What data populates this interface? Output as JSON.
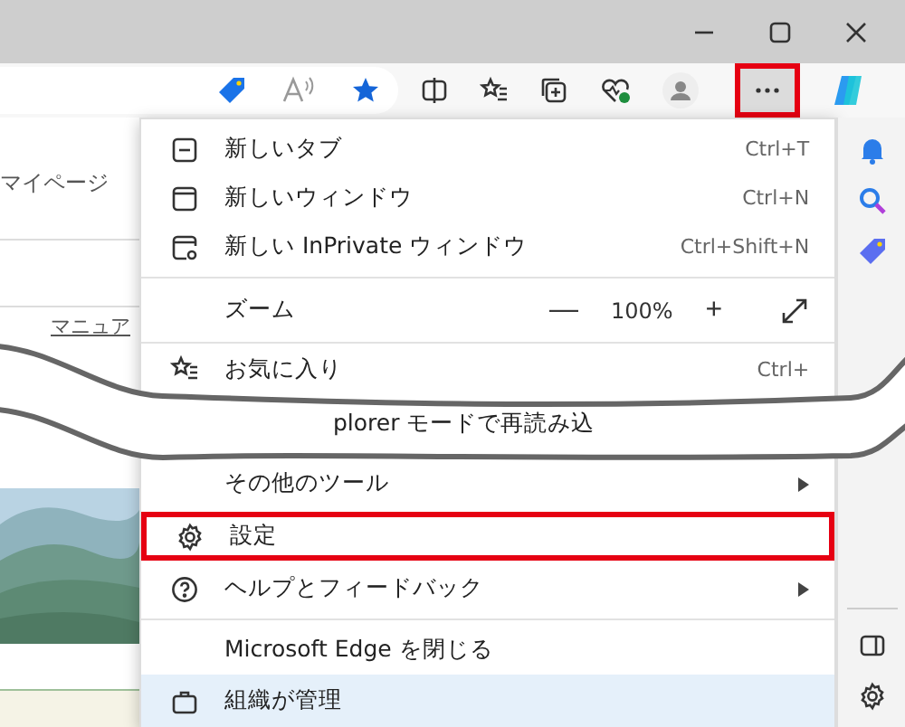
{
  "toolbar": {
    "more_button": {
      "highlighted": true
    }
  },
  "page": {
    "links": [
      "マイページ",
      "マニュア"
    ]
  },
  "menu": {
    "items": [
      {
        "kind": "item",
        "label": "新しいタブ",
        "shortcut": "Ctrl+T",
        "submenu": false,
        "highlighted": false
      },
      {
        "kind": "item",
        "label": "新しいウィンドウ",
        "shortcut": "Ctrl+N",
        "submenu": false,
        "highlighted": false
      },
      {
        "kind": "item",
        "label": "新しい InPrivate ウィンドウ",
        "shortcut": "Ctrl+Shift+N",
        "submenu": false,
        "highlighted": false
      },
      {
        "kind": "divider"
      },
      {
        "kind": "zoom",
        "label": "ズーム",
        "minus": "—",
        "value": "100%",
        "plus": "+"
      },
      {
        "kind": "divider"
      },
      {
        "kind": "item",
        "label": "お気に入り",
        "shortcut": "Ctrl+",
        "submenu": false,
        "highlighted": false
      },
      {
        "kind": "cut",
        "label": "plorer モードで再読み込"
      },
      {
        "kind": "item",
        "label": "その他のツール",
        "submenu": true,
        "highlighted": false
      },
      {
        "kind": "item",
        "label": "設定",
        "submenu": false,
        "highlighted": true
      },
      {
        "kind": "item",
        "label": "ヘルプとフィードバック",
        "submenu": true,
        "highlighted": false
      },
      {
        "kind": "divider"
      },
      {
        "kind": "item",
        "label": "Microsoft Edge を閉じる",
        "submenu": false,
        "highlighted": false
      },
      {
        "kind": "managed",
        "label": "組織が管理"
      }
    ]
  }
}
